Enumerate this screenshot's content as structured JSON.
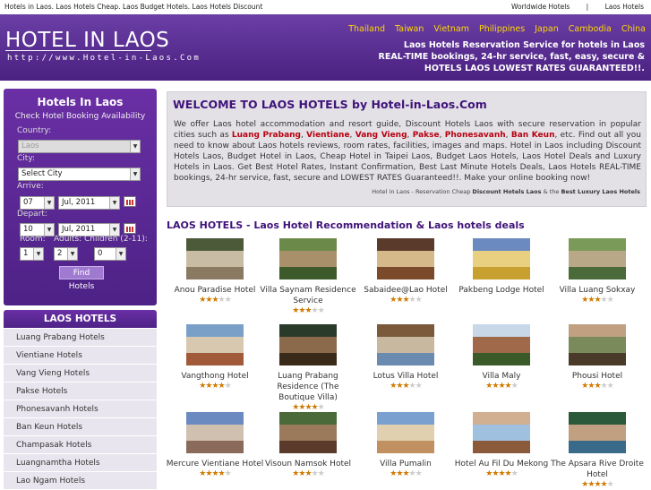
{
  "topbar": {
    "keywords": "Hotels in Laos. Laos Hotels Cheap. Laos Budget Hotels. Laos Hotels Discount",
    "links": [
      "Worldwide Hotels",
      "|",
      "Laos Hotels"
    ]
  },
  "header": {
    "logo": "HOTEL IN LAOS",
    "url": "http://www.Hotel-in-Laos.Com",
    "countries": [
      "Thailand",
      "Taiwan",
      "Vietnam",
      "Philippines",
      "Japan",
      "Cambodia",
      "China"
    ],
    "tagline": [
      "Laos Hotels Reservation Service for hotels in Laos",
      "REAL-TIME bookings, 24-hr service, fast, easy, secure &",
      "HOTELS LAOS LOWEST RATES GUARANTEED!!."
    ]
  },
  "booking": {
    "title": "Hotels In Laos",
    "subtitle": "Check Hotel Booking Availability",
    "country_label": "Country:",
    "country_value": "Laos",
    "city_label": "City:",
    "city_value": "Select City",
    "arrive_label": "Arrive:",
    "arrive_day": "07",
    "arrive_month": "Jul, 2011",
    "depart_label": "Depart:",
    "depart_day": "10",
    "depart_month": "Jul, 2011",
    "room_label": "Room:",
    "room_value": "1",
    "adults_label": "Adults:",
    "adults_value": "2",
    "children_label": "Children (2-11):",
    "children_value": "0",
    "find_button": "Find Hotels"
  },
  "sidebar": {
    "heading": "LAOS HOTELS",
    "items": [
      "Luang Prabang Hotels",
      "Vientiane Hotels",
      "Vang Vieng Hotels",
      "Pakse Hotels",
      "Phonesavanh Hotels",
      "Ban Keun Hotels",
      "Champasak Hotels",
      "Luangnamtha Hotels",
      "Lao Ngam Hotels"
    ]
  },
  "welcome": {
    "title": "WELCOME TO LAOS HOTELS by Hotel-in-Laos.Com",
    "p1": "We offer Laos hotel accommodation and resort guide, Discount Hotels Laos with secure reservation in popular cities such as",
    "cities": [
      "Luang Prabang",
      "Vientiane",
      "Vang Vieng",
      "Pakse",
      "Phonesavanh",
      "Ban Keun"
    ],
    "p2": ", etc. Find out all you need to know about Laos hotels reviews, room rates, facilities, images and maps. Hotel in Laos including Discount Hotels Laos, Budget Hotel in Laos, Cheap Hotel in Taipei Laos, Budget Laos Hotels, Laos Hotel Deals and Luxury Hotels in Laos. Get Best Hotel Rates, Instant Confirmation, Best Last Minute Hotels Deals, Laos Hotels REAL-TIME bookings, 24-hr service, fast, secure and LOWEST RATES Guaranteed!!. Make your online booking now!",
    "foot_a": "Hotel in Laos - Reservation Cheap ",
    "foot_b": "Discount Hotels Laos",
    "foot_c": " & the ",
    "foot_d": "Best Luxury Laos Hotels"
  },
  "section_title": "LAOS HOTELS - Laos Hotel Recommendation & Laos hotels deals",
  "hotels": [
    {
      "name": "Anou Paradise Hotel",
      "stars": 3
    },
    {
      "name": "Villa Saynam Residence Service",
      "stars": 3
    },
    {
      "name": "Sabaidee@Lao Hotel",
      "stars": 3
    },
    {
      "name": "Pakbeng Lodge Hotel",
      "stars": 0
    },
    {
      "name": "Villa Luang Sokxay",
      "stars": 3
    },
    {
      "name": "Vangthong Hotel",
      "stars": 4
    },
    {
      "name": "Luang Prabang Residence (The Boutique Villa)",
      "stars": 4
    },
    {
      "name": "Lotus Villa Hotel",
      "stars": 3
    },
    {
      "name": "Villa Maly",
      "stars": 4
    },
    {
      "name": "Phousi Hotel",
      "stars": 3
    },
    {
      "name": "Mercure Vientiane Hotel",
      "stars": 4
    },
    {
      "name": "Visoun Namsok Hotel",
      "stars": 3
    },
    {
      "name": "Villa Pumalin",
      "stars": 3
    },
    {
      "name": "Hotel Au Fil Du Mekong",
      "stars": 4
    },
    {
      "name": "The Apsara Rive Droite Hotel",
      "stars": 4
    }
  ],
  "colors": {
    "brand_purple": "#5a2a96",
    "title_purple": "#40137a",
    "city_red": "#b8000f",
    "country_gold": "#ffd700",
    "star": "#d07a00"
  }
}
